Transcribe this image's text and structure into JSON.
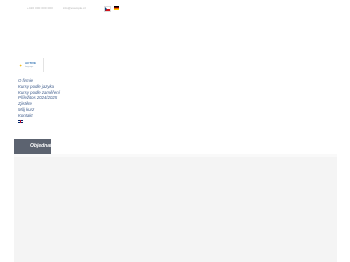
{
  "topbar": {
    "phone": "+420 000 000 000",
    "email": "info@example.cz"
  },
  "languages": {
    "cz_icon": "flag-cz-icon",
    "de_icon": "flag-de-icon",
    "en_icon": "flag-en-icon"
  },
  "logo": {
    "mark": "✦",
    "name": "ACTIVE",
    "sub": "language"
  },
  "nav": {
    "items": [
      {
        "label": "O firmie"
      },
      {
        "label": "Kursy podle jazyka"
      },
      {
        "label": "Kursy podle zaměření"
      },
      {
        "label": "Příležitos 2024/2025"
      },
      {
        "label": "Zjistěte"
      },
      {
        "label": "Můj kurz"
      },
      {
        "label": "Kontakt"
      }
    ]
  },
  "order_button": {
    "label": "Objednat"
  },
  "colors": {
    "nav_text": "#3c5a8a",
    "button_bg": "#5c6370",
    "panel_bg": "#f4f4f4"
  }
}
